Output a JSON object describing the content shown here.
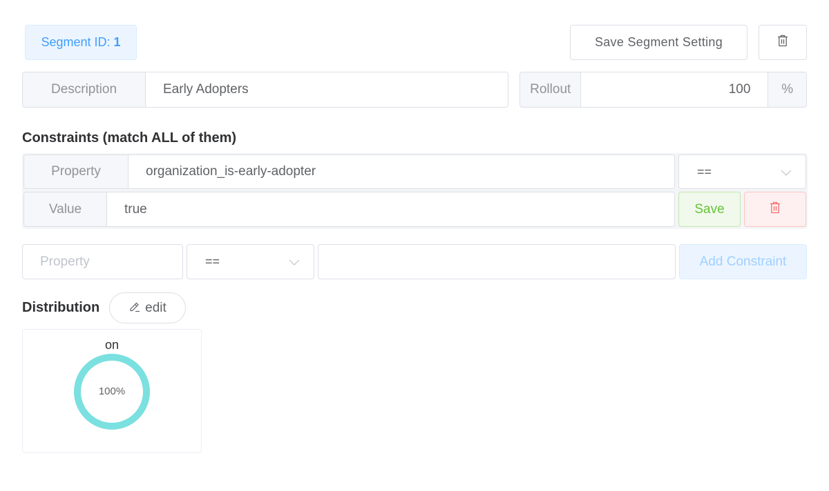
{
  "segment": {
    "id_label": "Segment ID:",
    "id_value": "1",
    "save_label": "Save Segment Setting",
    "delete_icon": "trash-icon"
  },
  "description": {
    "label": "Description",
    "value": "Early Adopters"
  },
  "rollout": {
    "label": "Rollout",
    "value": "100",
    "suffix": "%"
  },
  "constraints": {
    "title": "Constraints (match ALL of them)",
    "items": [
      {
        "property_label": "Property",
        "property": "organization_is-early-adopter",
        "operator": "==",
        "value_label": "Value",
        "value": "true",
        "save_label": "Save",
        "delete_icon": "trash-icon"
      }
    ],
    "new": {
      "property_placeholder": "Property",
      "operator": "==",
      "value": "",
      "add_label": "Add Constraint"
    }
  },
  "distribution": {
    "title": "Distribution",
    "edit_label": "edit",
    "variants": [
      {
        "key": "on",
        "percent": 100,
        "percent_label": "100%",
        "color": "#7be0e0"
      }
    ]
  }
}
